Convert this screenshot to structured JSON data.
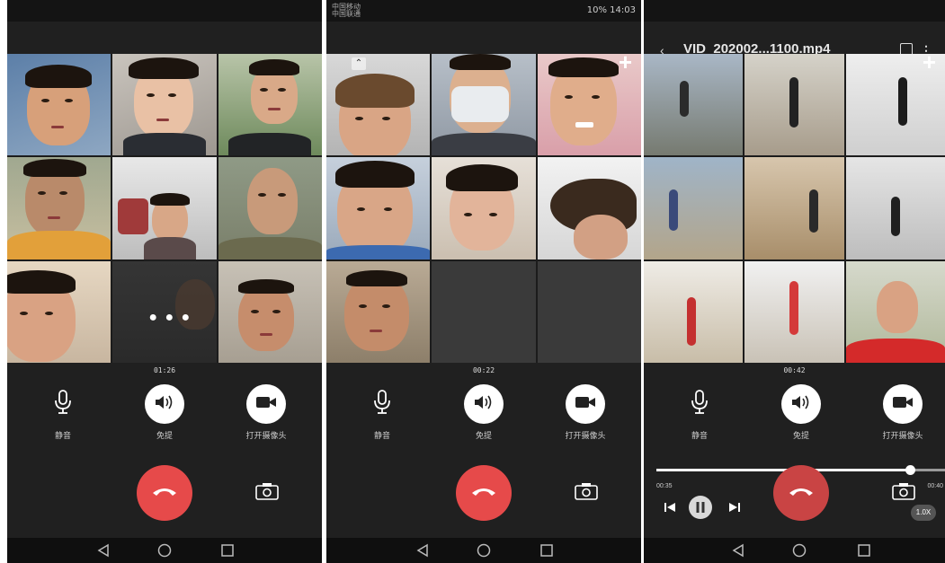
{
  "phones": [
    {
      "status": {
        "left_line1": "",
        "left_line2": "",
        "right": ""
      },
      "timer": "01:26",
      "controls": {
        "mute": "静音",
        "speaker": "免提",
        "camera": "打开摄像头"
      }
    },
    {
      "status": {
        "left_line1": "中国移动",
        "left_line2": "中国联通",
        "right": "10% 14:03"
      },
      "timer": "00:22",
      "controls": {
        "mute": "静音",
        "speaker": "免提",
        "camera": "打开摄像头"
      }
    },
    {
      "title": "VID_202002...1100.mp4",
      "timer": "00:42",
      "controls": {
        "mute": "静音",
        "speaker": "免提",
        "camera": "打开摄像头"
      },
      "player": {
        "position": "00:35",
        "duration": "00:40",
        "progress": 0.88,
        "speed": "1.0X"
      }
    }
  ],
  "colors": {
    "background": "#202020",
    "hangup": "#e64a4a",
    "control_circle": "#ffffff",
    "empty_tile": "#3a3a3a"
  },
  "icons": [
    "microphone-icon",
    "speaker-icon",
    "video-camera-icon",
    "hangup-icon",
    "camera-flip-icon",
    "plus-icon",
    "nav-back-icon",
    "nav-home-icon",
    "nav-recent-icon",
    "play-pause-icon",
    "skip-previous-icon",
    "skip-next-icon"
  ]
}
